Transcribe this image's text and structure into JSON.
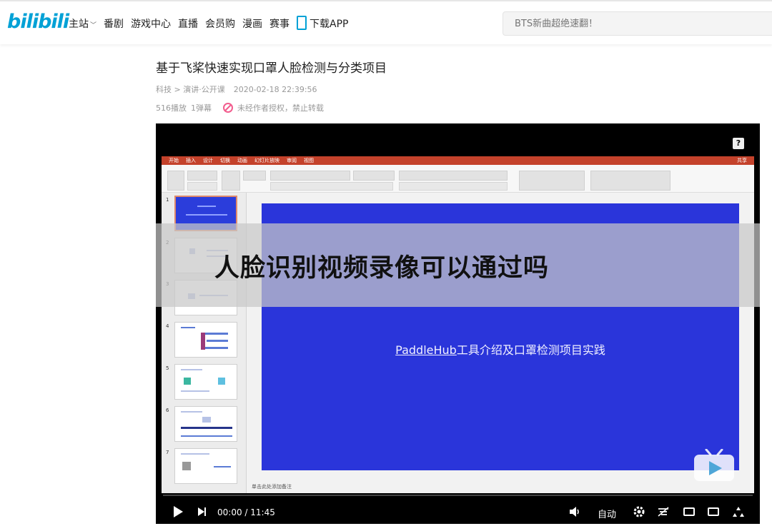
{
  "header": {
    "logo": "bilibili",
    "nav": [
      {
        "label": "主站",
        "has_dropdown": true
      },
      {
        "label": "番剧"
      },
      {
        "label": "游戏中心"
      },
      {
        "label": "直播"
      },
      {
        "label": "会员购"
      },
      {
        "label": "漫画"
      },
      {
        "label": "赛事"
      },
      {
        "label": "下载APP",
        "icon": "phone-icon"
      }
    ],
    "search": {
      "placeholder": "BTS新曲超绝速翻！"
    }
  },
  "video": {
    "title": "基于飞桨快速实现口罩人脸检测与分类项目",
    "category": "科技 > 演讲·公开课",
    "date": "2020-02-18 22:39:56",
    "views": "516播放",
    "danmaku": "1弹幕",
    "copyright": "未经作者授权，禁止转载"
  },
  "player": {
    "help_label": "?",
    "overlay_title": "人脸识别视频录像可以通过吗",
    "slide_title_prefix": "PaddleHub",
    "slide_title_rest": "工具介绍及口罩检测项目实践",
    "notes_placeholder": "单击此处添加备注",
    "ppt_tabs": [
      "开始",
      "插入",
      "设计",
      "切换",
      "动画",
      "幻灯片放映",
      "审阅",
      "视图"
    ],
    "ppt_share": "共享",
    "slide_numbers": [
      "1",
      "2",
      "3",
      "4",
      "5",
      "6",
      "7"
    ],
    "time": "00:00 / 11:45",
    "auto_label": "自动",
    "progress": 0.0
  },
  "colors": {
    "brand": "#00a1d6",
    "slide_blue": "#2a35da",
    "ppt_red": "#c4422b",
    "ban": "#f25d8e"
  }
}
